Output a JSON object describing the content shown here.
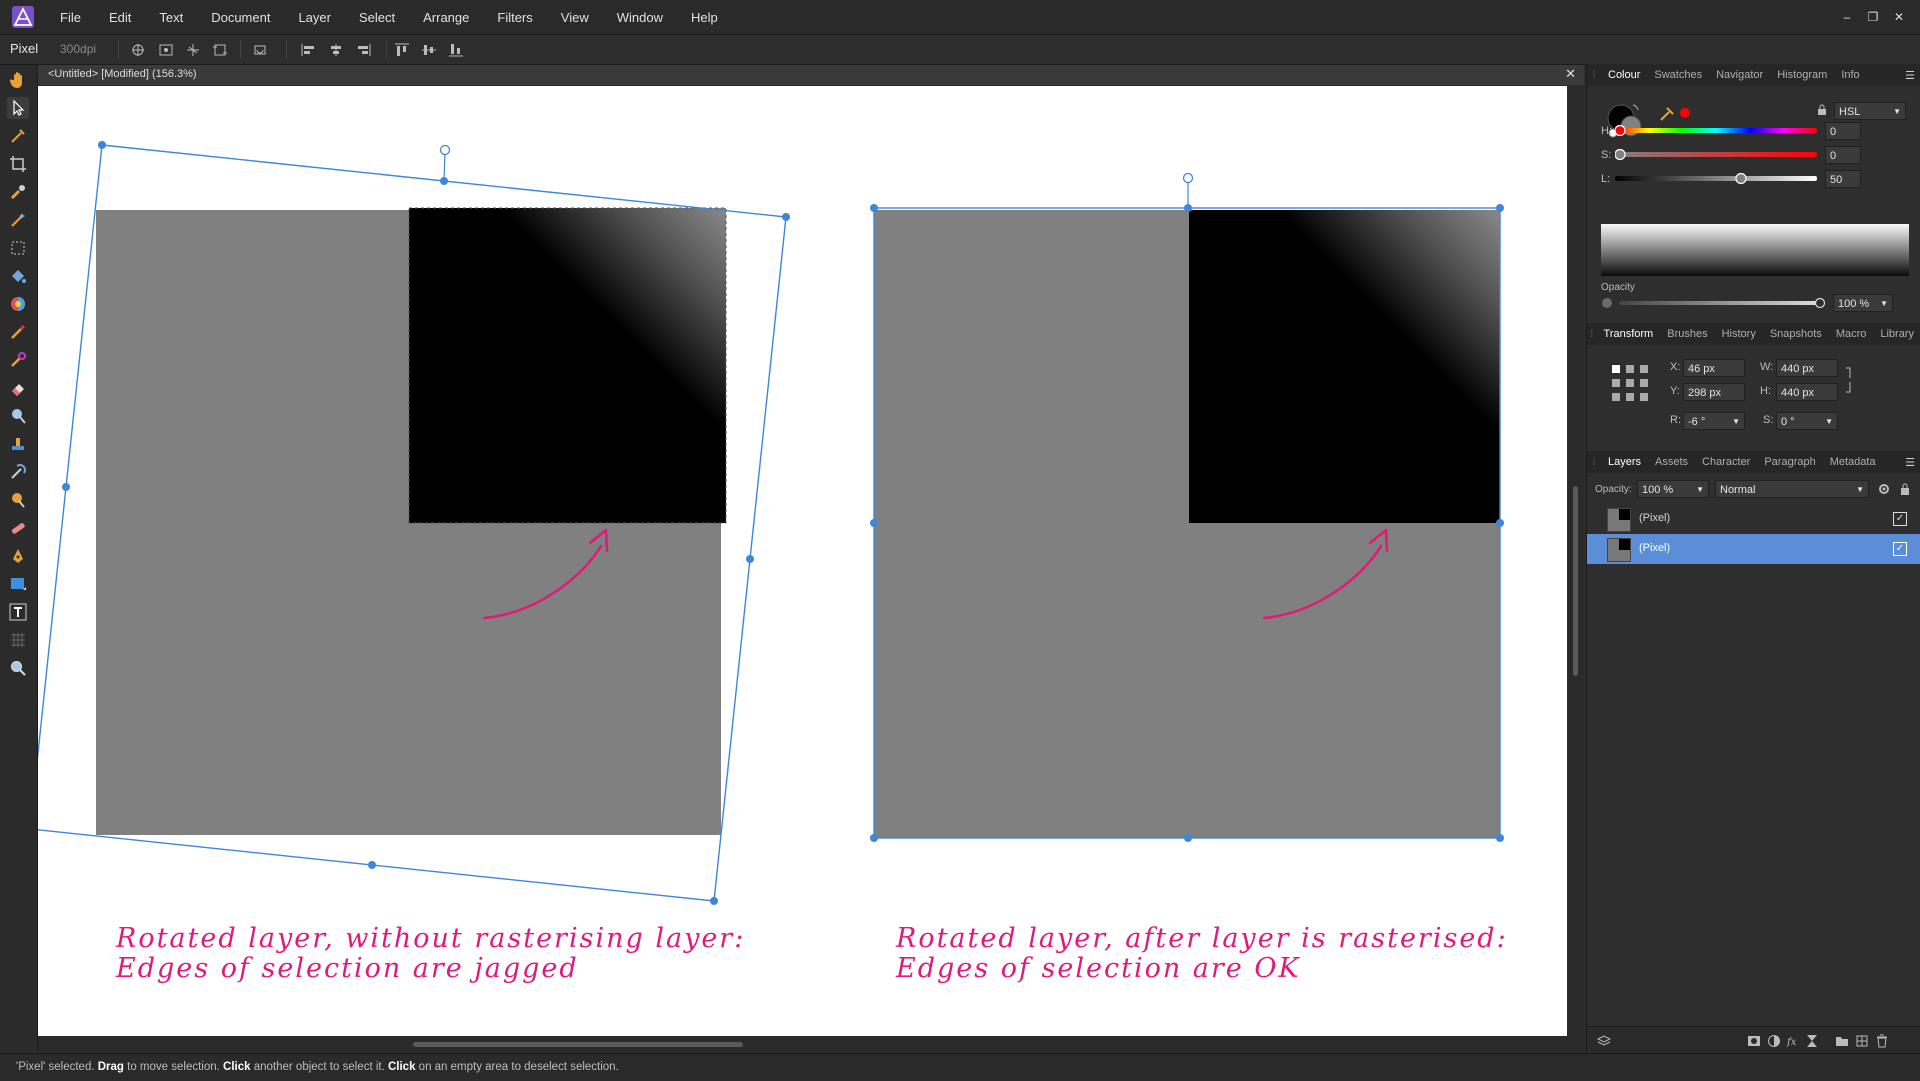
{
  "menubar": {
    "items": [
      "File",
      "Edit",
      "Text",
      "Document",
      "Layer",
      "Select",
      "Arrange",
      "Filters",
      "View",
      "Window",
      "Help"
    ],
    "window_controls": [
      "–",
      "❐",
      "✕"
    ]
  },
  "context_toolbar": {
    "mode": "Pixel",
    "dpi": "300dpi"
  },
  "document": {
    "title": "<Untitled> [Modified] (156.3%)",
    "close": "✕"
  },
  "canvas": {
    "captions": {
      "left_line1": "Rotated layer, without rasterising layer:",
      "left_line2": "Edges of selection are jagged",
      "right_line1": "Rotated layer, after layer is rasterised:",
      "right_line2": "Edges of selection are OK"
    },
    "colors": {
      "annotation": "#e0197a",
      "selection": "#3f86d8",
      "layer_gray": "#808080"
    }
  },
  "status": {
    "p1": "'Pixel' selected. ",
    "b1": "Drag",
    "p2": " to move selection. ",
    "b2": "Click",
    "p3": " another object to select it. ",
    "b3": "Click",
    "p4": " on an empty area to deselect selection."
  },
  "colour_panel": {
    "tabs": [
      "Colour",
      "Swatches",
      "Navigator",
      "Histogram",
      "Info"
    ],
    "model": "HSL",
    "h_label": "H:",
    "h_value": "0",
    "s_label": "S:",
    "s_value": "0",
    "l_label": "L:",
    "l_value": "50",
    "opacity_label": "Opacity",
    "opacity_value": "100 %"
  },
  "transform_panel": {
    "tabs": [
      "Transform",
      "Brushes",
      "History",
      "Snapshots",
      "Macro",
      "Library"
    ],
    "x_label": "X:",
    "x_value": "46 px",
    "y_label": "Y:",
    "y_value": "298 px",
    "w_label": "W:",
    "w_value": "440 px",
    "h_label": "H:",
    "h_value": "440 px",
    "r_label": "R:",
    "r_value": "-6 °",
    "s_label": "S:",
    "s_value": "0 °"
  },
  "layers_panel": {
    "tabs": [
      "Layers",
      "Assets",
      "Character",
      "Paragraph",
      "Metadata"
    ],
    "opacity_label": "Opacity:",
    "opacity_value": "100 %",
    "blend_mode": "Normal",
    "layers": [
      {
        "name": "(Pixel)",
        "selected": false
      },
      {
        "name": "(Pixel)",
        "selected": true
      }
    ]
  }
}
